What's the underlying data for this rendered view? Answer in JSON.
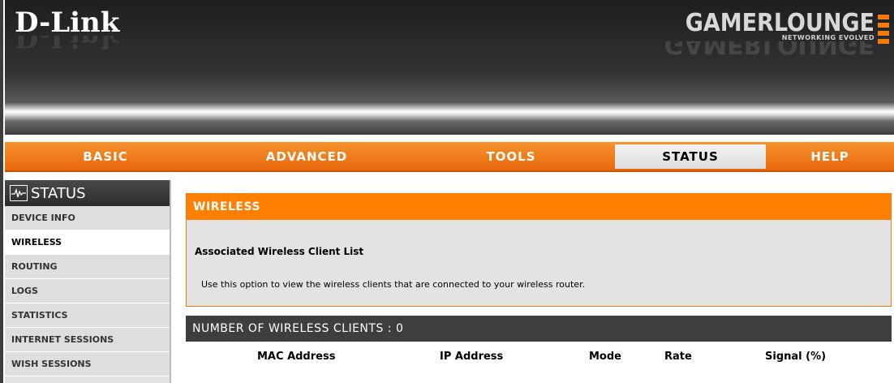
{
  "header": {
    "brand": "D-Link",
    "product_title": "GAMERLOUNGE",
    "product_tagline": "NETWORKING EVOLVED"
  },
  "nav": {
    "tabs": [
      {
        "label": "BASIC"
      },
      {
        "label": "ADVANCED"
      },
      {
        "label": "TOOLS"
      },
      {
        "label": "STATUS",
        "active": true
      },
      {
        "label": "HELP"
      }
    ]
  },
  "sidebar": {
    "title": "STATUS",
    "items": [
      {
        "label": "DEVICE INFO"
      },
      {
        "label": "WIRELESS",
        "active": true
      },
      {
        "label": "ROUTING"
      },
      {
        "label": "LOGS"
      },
      {
        "label": "STATISTICS"
      },
      {
        "label": "INTERNET SESSIONS"
      },
      {
        "label": "WISH SESSIONS"
      }
    ]
  },
  "wireless_panel": {
    "title": "WIRELESS",
    "subtitle": "Associated Wireless Client List",
    "description": "Use this option to view the wireless clients that are connected to your wireless router."
  },
  "clients_table": {
    "title": "NUMBER OF WIRELESS CLIENTS : 0",
    "columns": [
      "MAC Address",
      "IP Address",
      "Mode",
      "Rate",
      "Signal (%)"
    ]
  },
  "colors": {
    "accent_orange": "#ff7f00",
    "banner_dark": "#2a2a2a",
    "table_header": "#3e3e3e"
  }
}
